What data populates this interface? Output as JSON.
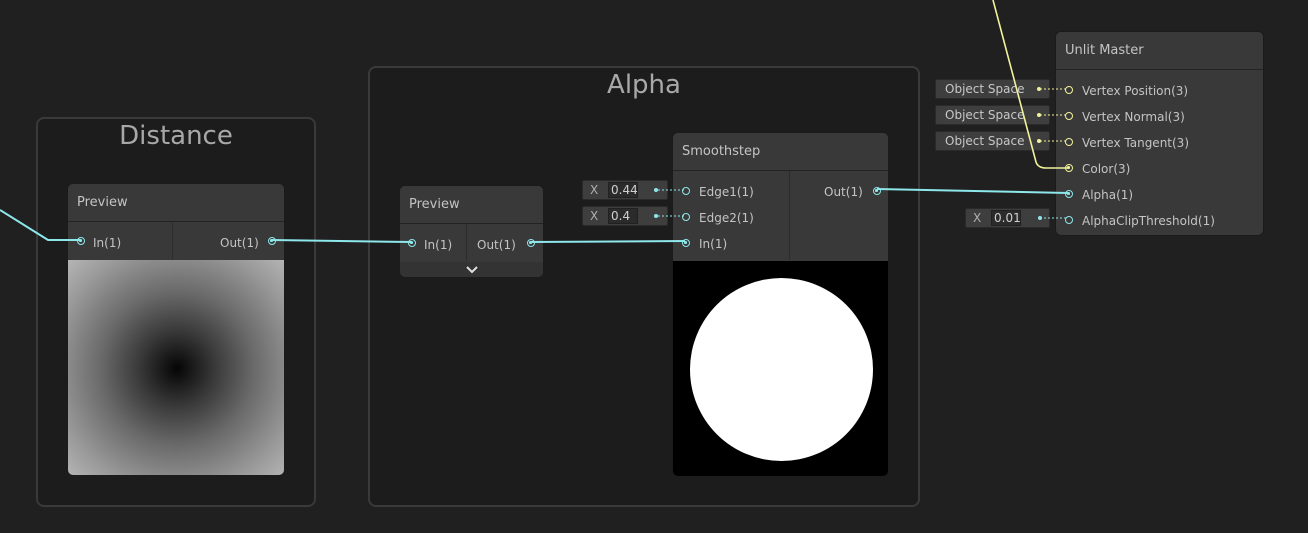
{
  "groups": {
    "distance": {
      "title": "Distance"
    },
    "alpha": {
      "title": "Alpha"
    }
  },
  "nodes": {
    "distance_preview": {
      "title": "Preview",
      "input": "In(1)",
      "output": "Out(1)"
    },
    "alpha_preview": {
      "title": "Preview",
      "input": "In(1)",
      "output": "Out(1)"
    },
    "smoothstep": {
      "title": "Smoothstep",
      "inputs": [
        "Edge1(1)",
        "Edge2(1)",
        "In(1)"
      ],
      "output": "Out(1)",
      "edge1_value": "0.44",
      "edge2_value": "0.4"
    },
    "unlit_master": {
      "title": "Unlit Master",
      "ports": [
        "Vertex Position(3)",
        "Vertex Normal(3)",
        "Vertex Tangent(3)",
        "Color(3)",
        "Alpha(1)",
        "AlphaClipThreshold(1)"
      ],
      "space_labels": [
        "Object Space",
        "Object Space",
        "Object Space"
      ],
      "alpha_clip_value": "0.01"
    }
  },
  "axis_label": "X",
  "icons": {
    "expand": "chevron-down-icon"
  },
  "colors": {
    "float_wire": "#8ee7ea",
    "vector3_wire": "#f2f29a",
    "background": "#202020"
  }
}
